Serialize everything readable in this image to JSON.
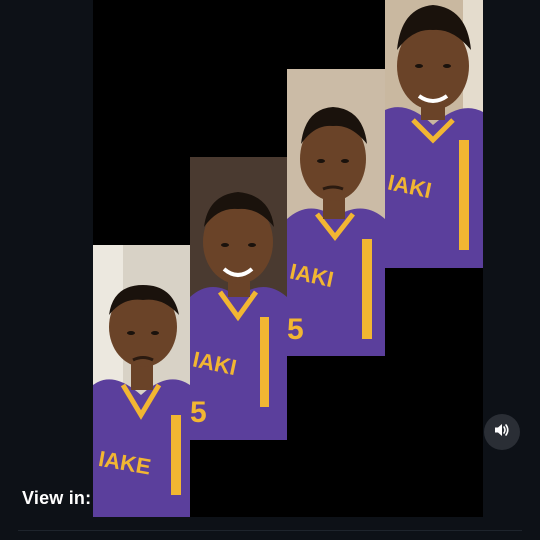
{
  "overlay": {
    "view_in_label": "View in:"
  },
  "controls": {
    "sound_button_icon": "speaker-volume-icon"
  },
  "media": {
    "panels": [
      {
        "description_icon": "photo-panel-1"
      },
      {
        "description_icon": "photo-panel-2"
      },
      {
        "description_icon": "photo-panel-3"
      },
      {
        "description_icon": "photo-panel-4"
      }
    ],
    "colors": {
      "jersey_purple": "#5b3f9c",
      "jersey_gold": "#f2b632",
      "skin": "#6a4328",
      "hair": "#1a120c",
      "wall": "#c9b8a0"
    }
  }
}
